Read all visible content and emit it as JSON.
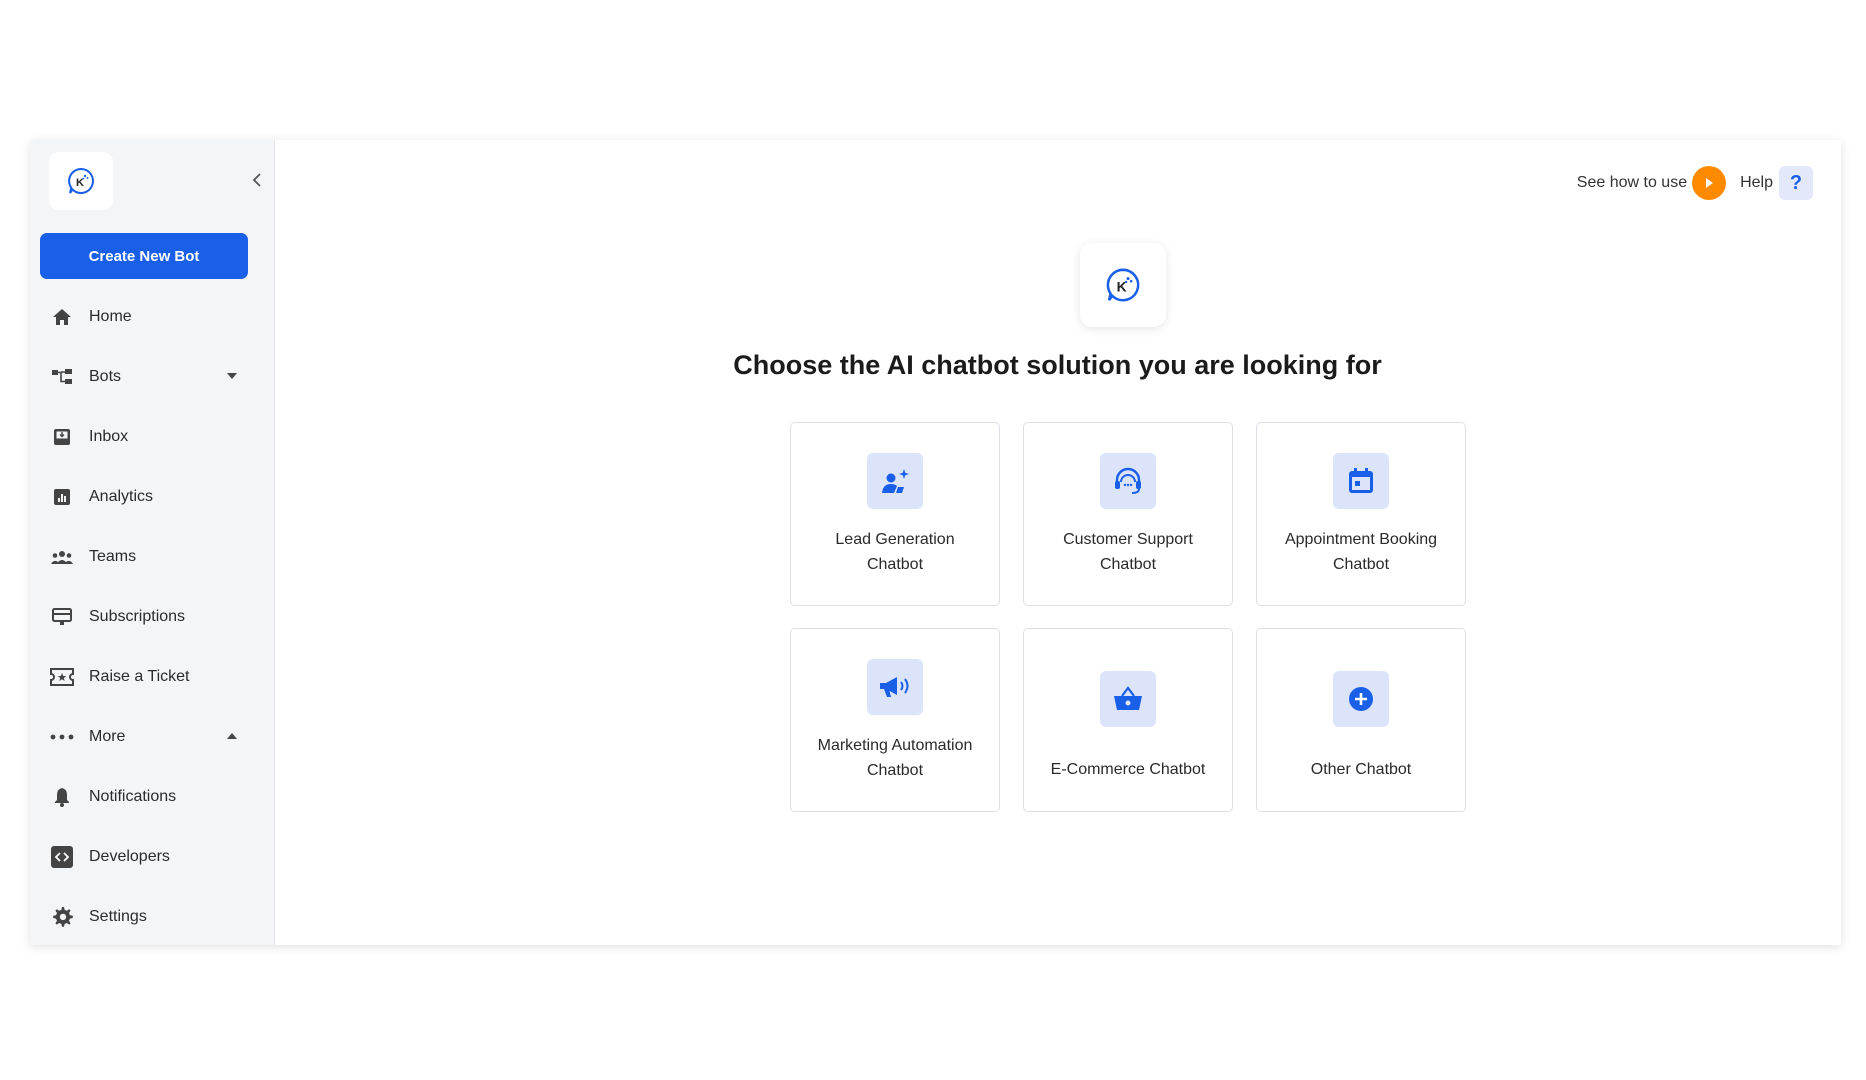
{
  "sidebar": {
    "create_button": "Create New Bot",
    "items": [
      {
        "label": "Home",
        "icon": "home-icon"
      },
      {
        "label": "Bots",
        "icon": "bots-icon"
      },
      {
        "label": "Inbox",
        "icon": "inbox-icon"
      },
      {
        "label": "Analytics",
        "icon": "analytics-icon"
      },
      {
        "label": "Teams",
        "icon": "teams-icon"
      },
      {
        "label": "Subscriptions",
        "icon": "subscriptions-icon"
      },
      {
        "label": "Raise a Ticket",
        "icon": "ticket-icon"
      },
      {
        "label": "More",
        "icon": "more-icon"
      },
      {
        "label": "Notifications",
        "icon": "bell-icon"
      },
      {
        "label": "Developers",
        "icon": "code-icon"
      },
      {
        "label": "Settings",
        "icon": "gear-icon"
      }
    ]
  },
  "topbar": {
    "see_how": "See how to use",
    "help": "Help",
    "help_glyph": "?"
  },
  "main": {
    "headline": "Choose the AI chatbot solution you are looking for",
    "cards": [
      {
        "line1": "Lead Generation",
        "line2": "Chatbot",
        "icon": "lead-generation-icon"
      },
      {
        "line1": "Customer Support",
        "line2": "Chatbot",
        "icon": "customer-support-icon"
      },
      {
        "line1": "Appointment Booking",
        "line2": "Chatbot",
        "icon": "calendar-icon"
      },
      {
        "line1": "Marketing Automation",
        "line2": "Chatbot",
        "icon": "megaphone-icon"
      },
      {
        "line1": "E-Commerce Chatbot",
        "icon": "basket-icon"
      },
      {
        "line1": "Other Chatbot",
        "icon": "plus-circle-icon"
      }
    ]
  },
  "colors": {
    "accent": "#1a5fe8",
    "play": "#ff8a00",
    "icon_bg": "#dbe4fb",
    "sidebar_bg": "#f4f5f7"
  }
}
